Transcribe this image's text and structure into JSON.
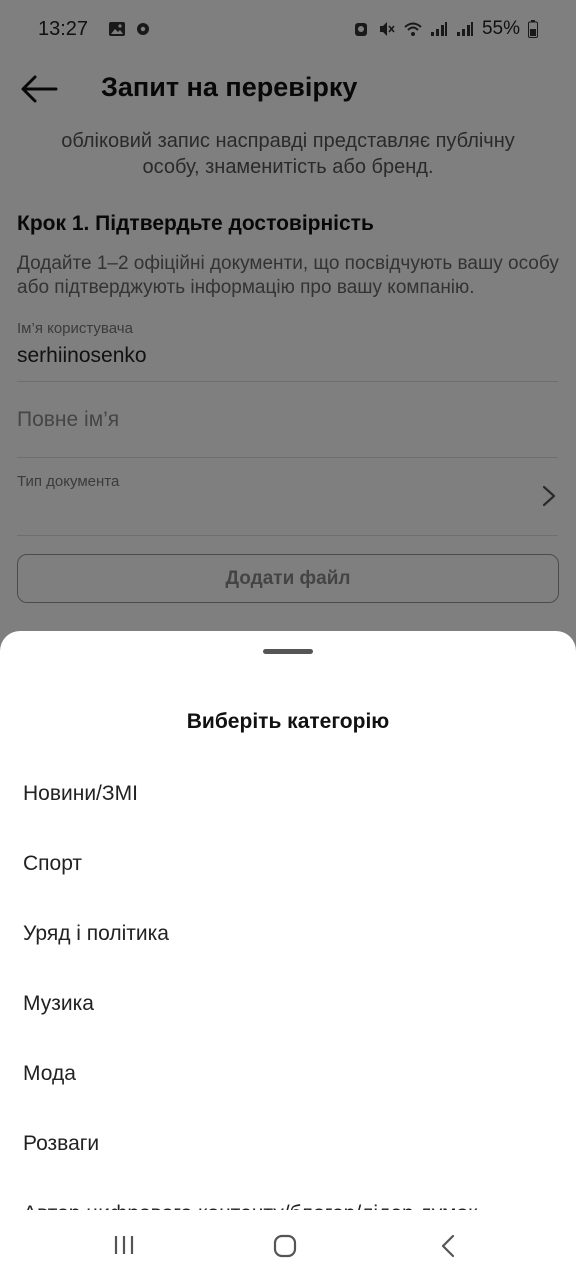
{
  "status_bar": {
    "time": "13:27",
    "battery": "55%",
    "left_icons": [
      "gallery-icon",
      "notification-icon"
    ],
    "right_icons": [
      "alarm-icon",
      "mute-icon",
      "wifi-icon",
      "signal-icon",
      "signal-icon",
      "battery-icon"
    ]
  },
  "header": {
    "title": "Запит на перевірку"
  },
  "intro": {
    "text": "обліковий запис насправді представляє публічну особу, знаменитість або бренд."
  },
  "step": {
    "title": "Крок 1. Підтвердьте достовірність",
    "description": "Додайте 1–2 офіційні документи, що посвідчують вашу особу або підтверджують інформацію про вашу компанію."
  },
  "form": {
    "username_label": "Ім’я користувача",
    "username_value": "serhiinosenko",
    "fullname_placeholder": "Повне ім’я",
    "doctype_label": "Тип документа",
    "add_file_label": "Додати файл"
  },
  "sheet": {
    "title": "Виберіть категорію",
    "categories": [
      "Новини/ЗМІ",
      "Спорт",
      "Уряд і політика",
      "Музика",
      "Мода",
      "Розваги",
      "Автор цифрового контенту/блогер/лідер думок"
    ]
  },
  "colors": {
    "scrim": "#000000",
    "text_primary": "#111111",
    "text_secondary": "#666666"
  }
}
